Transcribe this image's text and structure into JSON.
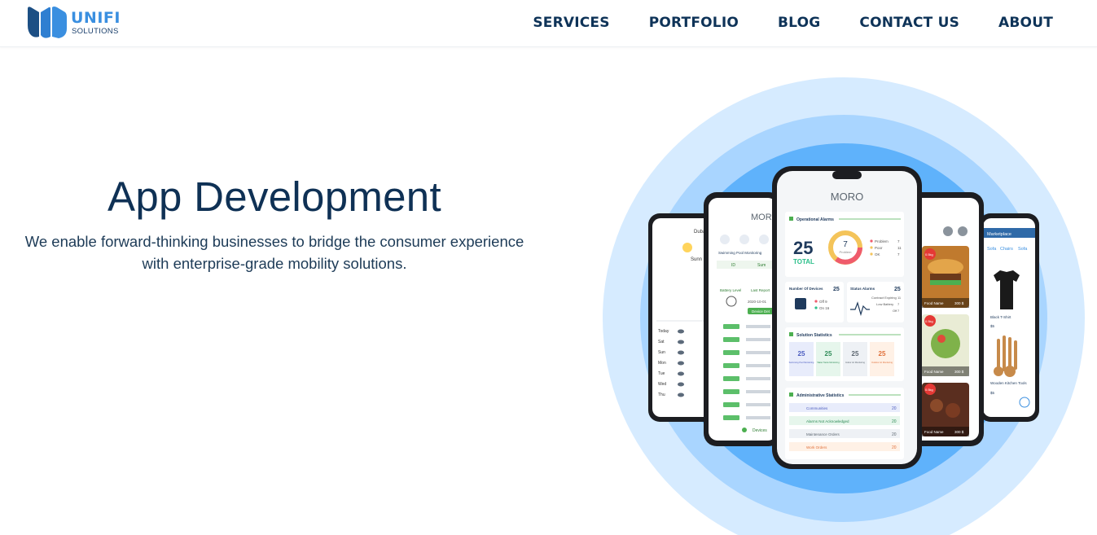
{
  "brand": {
    "name": "UNIFI",
    "subtitle": "SOLUTIONS"
  },
  "nav": {
    "items": [
      {
        "label": "SERVICES"
      },
      {
        "label": "PORTFOLIO"
      },
      {
        "label": "BLOG"
      },
      {
        "label": "CONTACT US"
      },
      {
        "label": "ABOUT"
      }
    ]
  },
  "hero": {
    "title": "App Development",
    "description": "We enable forward-thinking businesses to bridge the consumer experience with enterprise-grade mobility solutions."
  },
  "phone_main": {
    "app_name": "MORO",
    "operational_alarms": "Operational Alarms",
    "total_value": "25",
    "total_label": "TOTAL",
    "donut_value": "7",
    "donut_label": "Problem",
    "legend": [
      {
        "label": "Problem",
        "value": "7"
      },
      {
        "label": "Poor",
        "value": "11"
      },
      {
        "label": "OK",
        "value": "7"
      }
    ],
    "devices_label": "Number Of Devices",
    "devices_value": "25",
    "devices_off": "Off  9",
    "devices_on": "On  16",
    "status_label": "Status Alarms",
    "status_value": "25",
    "status_rows": [
      {
        "label": "Contract Expiring",
        "value": "11"
      },
      {
        "label": "Low Battery",
        "value": "7"
      },
      {
        "label": "Off",
        "value": "7"
      }
    ],
    "solution_label": "Solution Statistics",
    "solutions": [
      {
        "value": "25",
        "label": "Swimming Pool Monitoring"
      },
      {
        "value": "25",
        "label": "Water Tanks Monitoring"
      },
      {
        "value": "25",
        "label": "Indoor Air Monitoring"
      },
      {
        "value": "25",
        "label": "Outdoor Air Monitoring"
      }
    ],
    "admin_label": "Administrative Statistics",
    "admin_rows": [
      {
        "label": "Communities",
        "value": "20"
      },
      {
        "label": "Alarms Not Acknowledged",
        "value": "20"
      },
      {
        "label": "Maintenance Orders",
        "value": "20"
      },
      {
        "label": "Work Orders",
        "value": "20"
      }
    ]
  },
  "phone_left": {
    "app_name": "MORO",
    "header": "Swimming Pool Monitoring",
    "col_a": "ID",
    "col_b": "Sum",
    "battery_label": "Battery Level",
    "last_report": "Last Report",
    "date": "2020-10-01",
    "device_button": "Device Det",
    "nav_label": "Devices"
  },
  "phone_far_left": {
    "city": "Dubai",
    "state": "Sunn",
    "days": [
      "Today",
      "Sat",
      "Sun",
      "Mon",
      "Tue",
      "Wed",
      "Thu"
    ]
  },
  "phone_right": {
    "badge": "0.5kg",
    "food_label": "Food Name",
    "price": "300 $"
  },
  "phone_far_right": {
    "title": "Marketplace",
    "tabs": [
      "Sofa",
      "Chairs",
      "Sofa"
    ],
    "item1": "Black T-Shirt",
    "item1_price": "$5",
    "item2": "Wooden Kitchen Tools",
    "item2_price": "$5"
  },
  "colors": {
    "primary": "#0f3155",
    "accent": "#3a8fe0",
    "circle_outer": "#d6ebff",
    "circle_mid": "#a9d5ff",
    "circle_inner": "#5fb2fb"
  }
}
